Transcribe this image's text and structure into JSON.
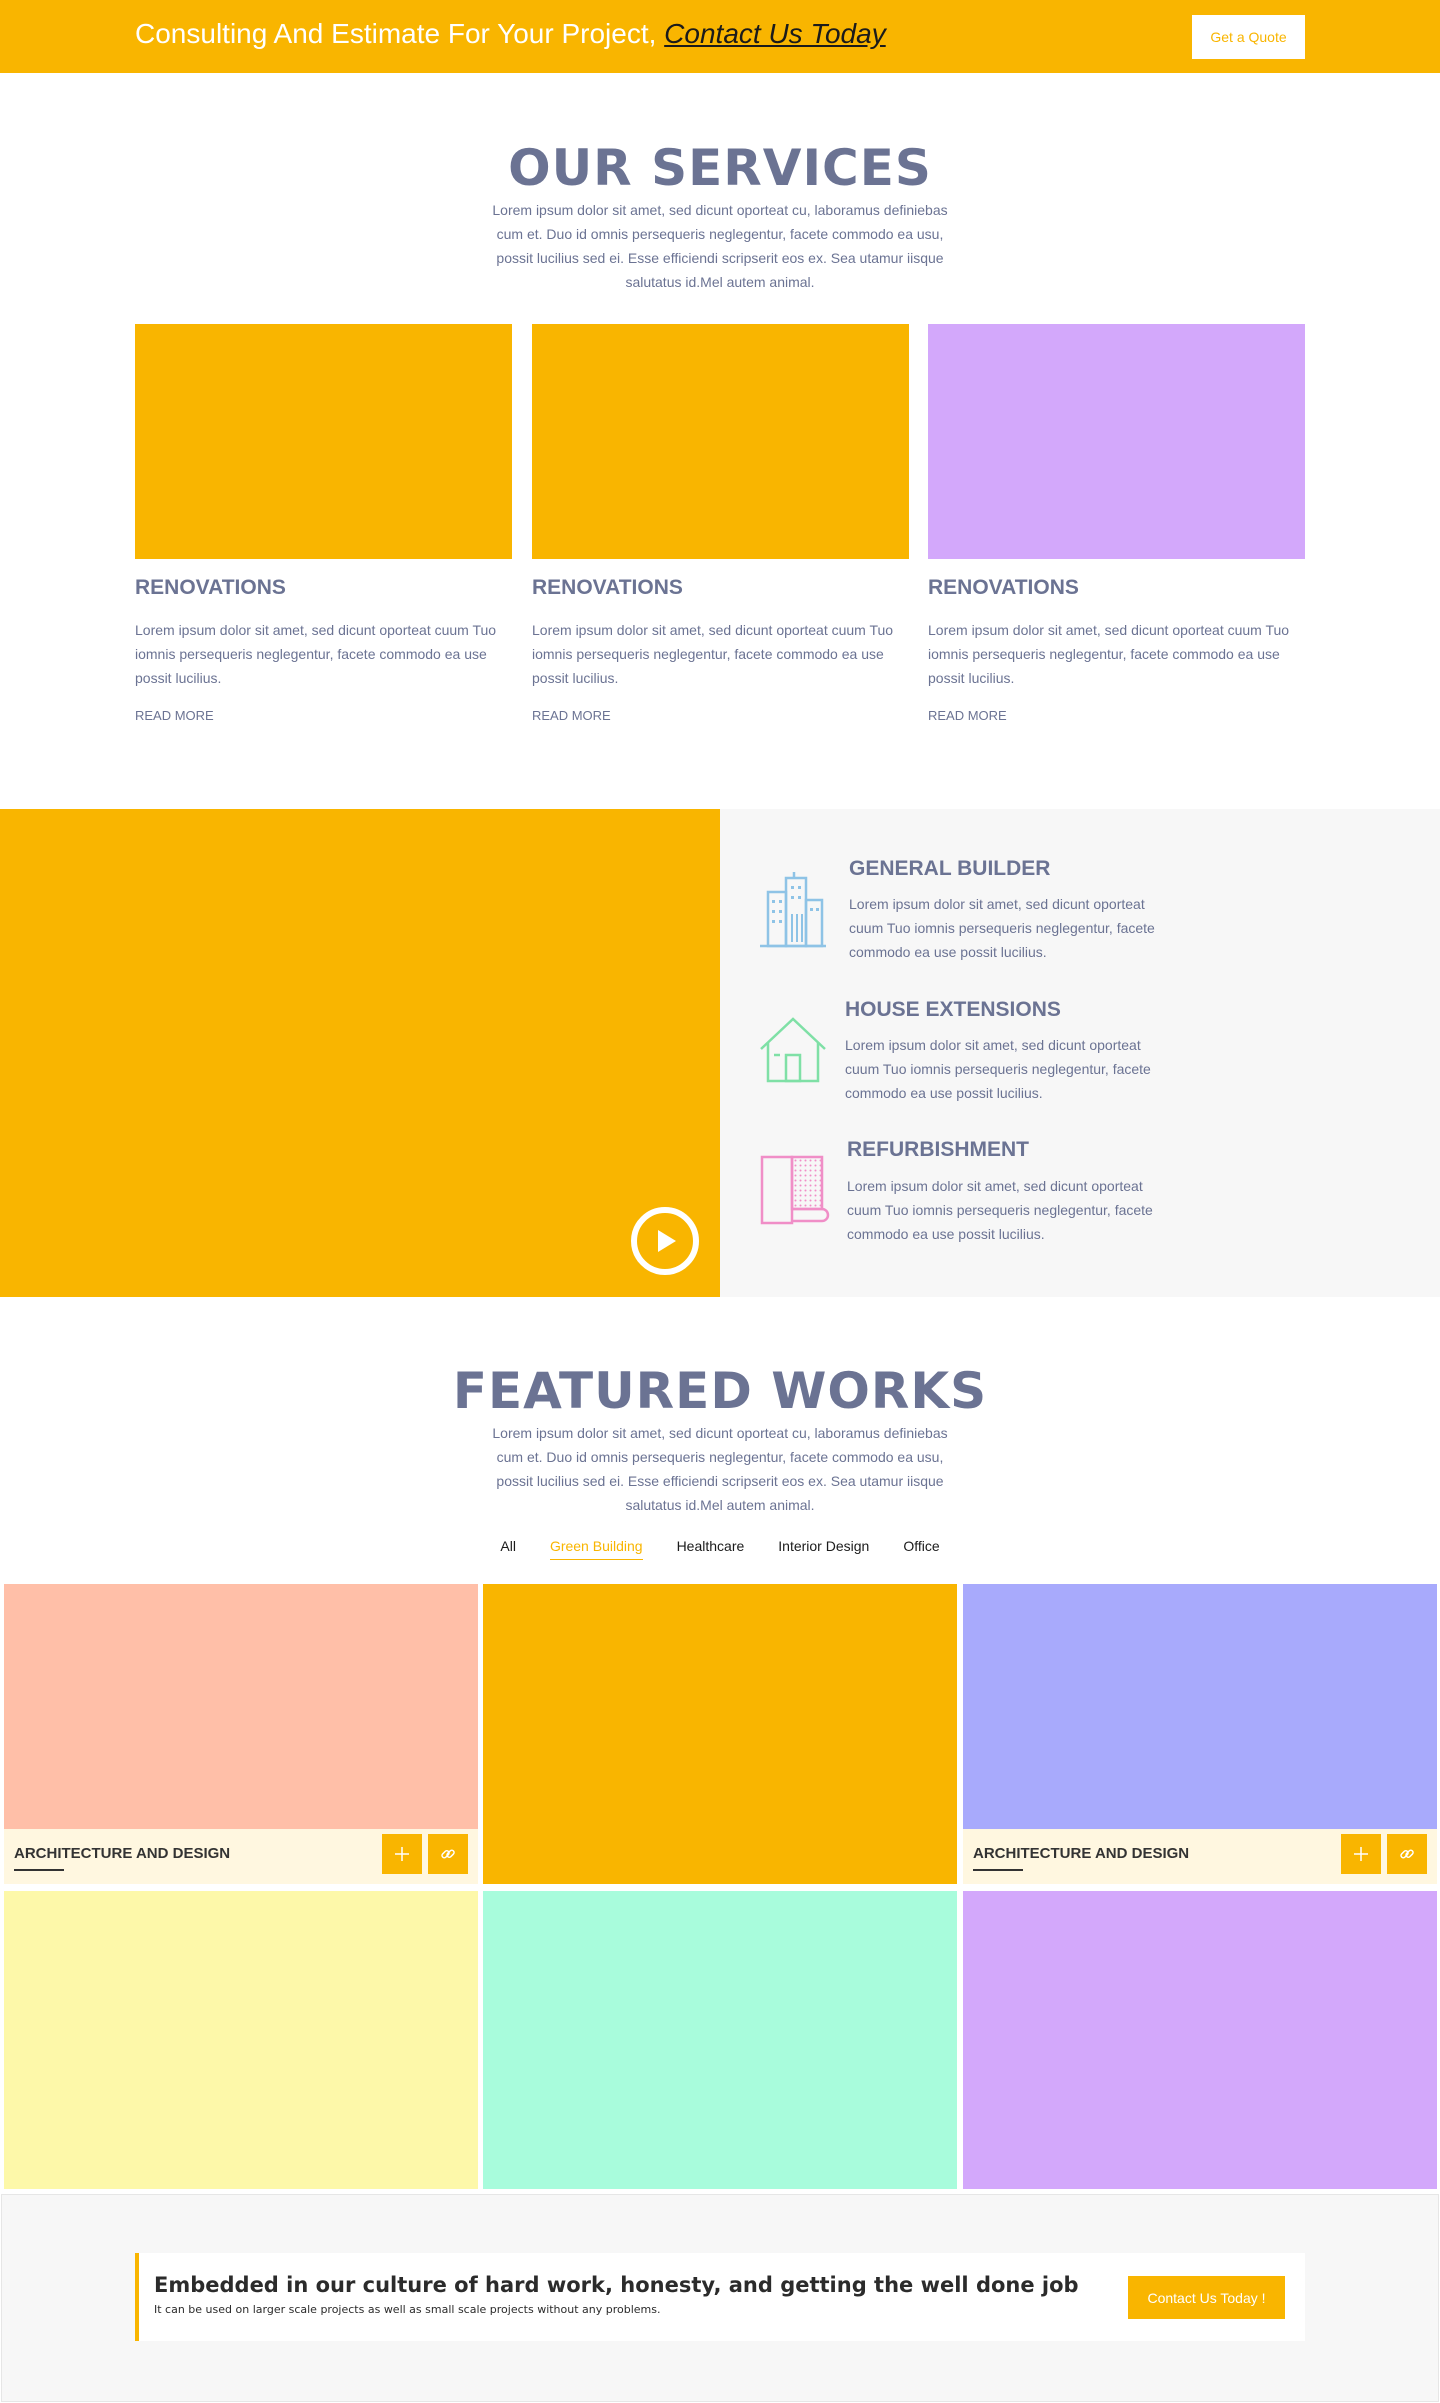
{
  "topbar": {
    "tagline": "Consulting And Estimate For Your Project,",
    "contact_link": "Contact Us Today",
    "quote_button": "Get a Quote"
  },
  "services": {
    "title": "OUR SERVICES",
    "lead": "Lorem ipsum dolor sit amet, sed dicunt oporteat cu, laboramus definiebas cum et. Duo id omnis persequeris neglegentur, facete commodo ea usu, possit lucilius sed ei. Esse efficiendi scripserit eos ex. Sea utamur iisque salutatus id.Mel autem animal.",
    "cards": [
      {
        "title": "RENOVATIONS",
        "text": "Lorem ipsum dolor sit amet, sed dicunt oporteat cuum Tuo iomnis persequeris neglegentur, facete commodo ea use possit lucilius.",
        "link": "READ MORE",
        "color": "#f9b500"
      },
      {
        "title": "RENOVATIONS",
        "text": "Lorem ipsum dolor sit amet, sed dicunt oporteat cuum Tuo iomnis persequeris neglegentur, facete commodo ea use possit lucilius.",
        "link": "READ MORE",
        "color": "#f9b500"
      },
      {
        "title": "RENOVATIONS",
        "text": "Lorem ipsum dolor sit amet, sed dicunt oporteat cuum Tuo iomnis persequeris neglegentur, facete commodo ea use possit lucilius.",
        "link": "READ MORE",
        "color": "#d3a8fb"
      }
    ]
  },
  "features": [
    {
      "icon": "building-icon",
      "title": "GENERAL BUILDER",
      "text": "Lorem ipsum dolor sit amet, sed dicunt oporteat cuum Tuo iomnis persequeris neglegentur, facete commodo ea use possit lucilius."
    },
    {
      "icon": "house-icon",
      "title": "HOUSE EXTENSIONS",
      "text": "Lorem ipsum dolor sit amet, sed dicunt oporteat cuum Tuo iomnis persequeris neglegentur, facete commodo ea use possit lucilius."
    },
    {
      "icon": "wallpaper-icon",
      "title": "REFURBISHMENT",
      "text": "Lorem ipsum dolor sit amet, sed dicunt oporteat cuum Tuo iomnis persequeris neglegentur, facete commodo ea use possit lucilius."
    }
  ],
  "works": {
    "title": "FEATURED WORKS",
    "lead": "Lorem ipsum dolor sit amet, sed dicunt oporteat cu, laboramus definiebas cum et. Duo id omnis persequeris neglegentur, facete commodo ea usu, possit lucilius sed ei. Esse efficiendi scripserit eos ex. Sea utamur iisque salutatus id.Mel autem animal.",
    "filters": [
      "All",
      "Green Building",
      "Healthcare",
      "Interior Design",
      "Office"
    ],
    "active_filter": "Green Building",
    "tiles": [
      {
        "color": "#ffbfa8",
        "caption": "ARCHITECTURE AND DESIGN"
      },
      {
        "color": "#f9b500",
        "caption": ""
      },
      {
        "color": "#a8aafc",
        "caption": "ARCHITECTURE AND DESIGN"
      },
      {
        "color": "#fdf8a9",
        "caption": ""
      },
      {
        "color": "#a8fcdc",
        "caption": ""
      },
      {
        "color": "#d3a8fb",
        "caption": ""
      }
    ]
  },
  "cta": {
    "heading": "Embedded in our culture of hard work, honesty, and getting the well done job",
    "sub": "It can be used on larger scale projects as well as small scale projects without any problems.",
    "button": "Contact Us Today !"
  },
  "colors": {
    "accent": "#f9b500",
    "text": "#6b7393",
    "panel": "#f7f7f7"
  }
}
